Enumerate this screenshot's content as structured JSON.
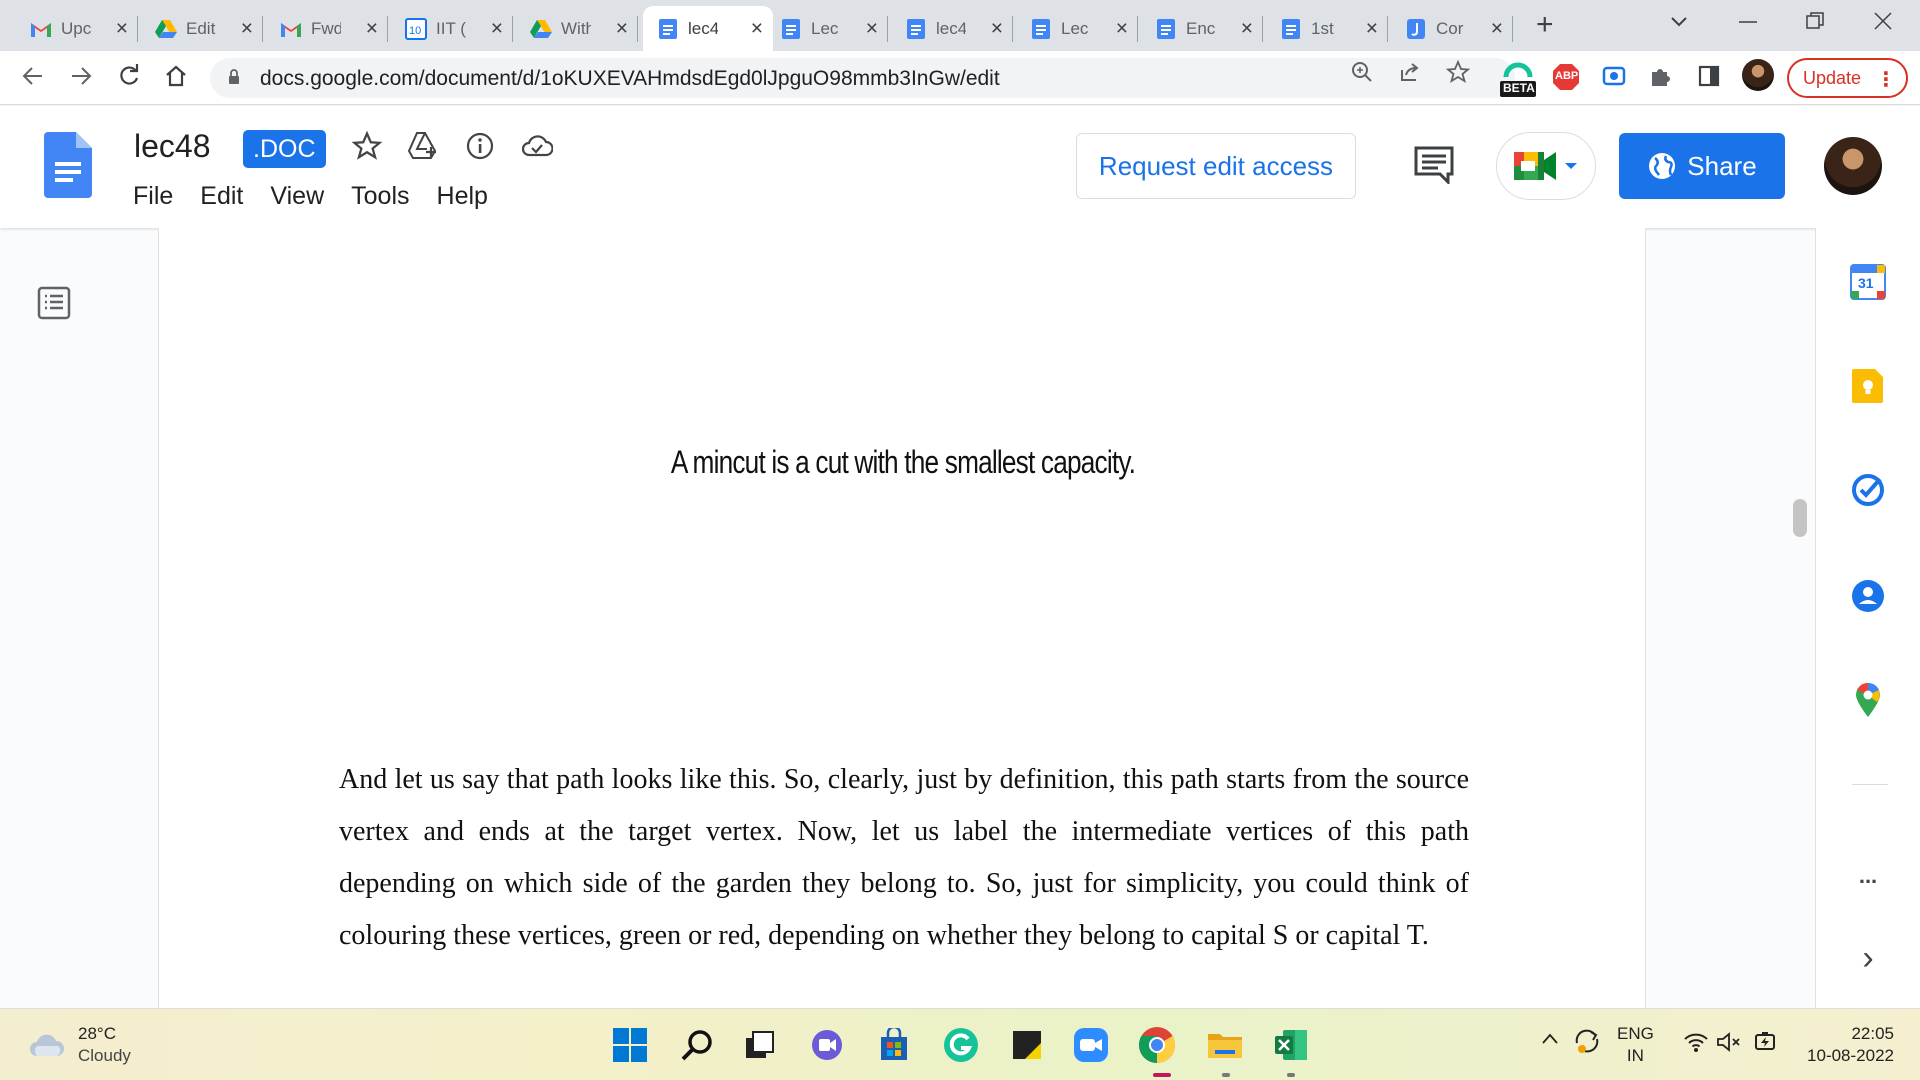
{
  "browser": {
    "tabs": [
      {
        "title": "Upc",
        "icon": "gmail-icon",
        "active": false
      },
      {
        "title": "Edit",
        "icon": "drive-icon",
        "active": false
      },
      {
        "title": "Fwd",
        "icon": "gmail-icon",
        "active": false
      },
      {
        "title": "IIT (",
        "icon": "calendar-10-icon",
        "active": false
      },
      {
        "title": "With",
        "icon": "drive-icon",
        "active": false
      },
      {
        "title": "lec4",
        "icon": "docs-icon",
        "active": true
      },
      {
        "title": "Lec",
        "icon": "docs-icon",
        "active": false
      },
      {
        "title": "lec4",
        "icon": "docs-icon",
        "active": false
      },
      {
        "title": "Lec",
        "icon": "docs-icon",
        "active": false
      },
      {
        "title": "Enc",
        "icon": "docs-icon",
        "active": false
      },
      {
        "title": "1st",
        "icon": "docs-icon",
        "active": false
      },
      {
        "title": "Cor",
        "icon": "jamboard-icon",
        "active": false
      }
    ],
    "new_tab": "+",
    "url": "docs.google.com/document/d/1oKUXEVAHmdsdEgd0lJpguO98mmb3InGw/edit",
    "ext_beta_label": "BETA",
    "ext_abp_label": "ABP",
    "update_label": "Update"
  },
  "doc": {
    "title": "lec48",
    "badge": ".DOC",
    "menu": [
      "File",
      "Edit",
      "View",
      "Tools",
      "Help"
    ],
    "request_access": "Request edit access",
    "share": "Share"
  },
  "content": {
    "heading": "A mincut is a cut with the smallest capacity.",
    "paragraph": "And let us say that path looks like this. So, clearly, just by definition, this path starts from the source vertex and ends at the target vertex. Now, let us label the intermediate vertices of this path depending on which side of the garden they belong to. So, just for simplicity, you could think of colouring these vertices, green or red, depending on whether they belong to capital S or capital T."
  },
  "side_panel": {
    "calendar_day": "31",
    "more": "...",
    "expand": "›"
  },
  "taskbar": {
    "temperature": "28°C",
    "weather": "Cloudy",
    "language": "ENG",
    "region": "IN",
    "time": "22:05",
    "date": "10-08-2022"
  },
  "colors": {
    "accent": "#1a73e8",
    "update_red": "#d93025",
    "tabstrip": "#dee1e6"
  }
}
